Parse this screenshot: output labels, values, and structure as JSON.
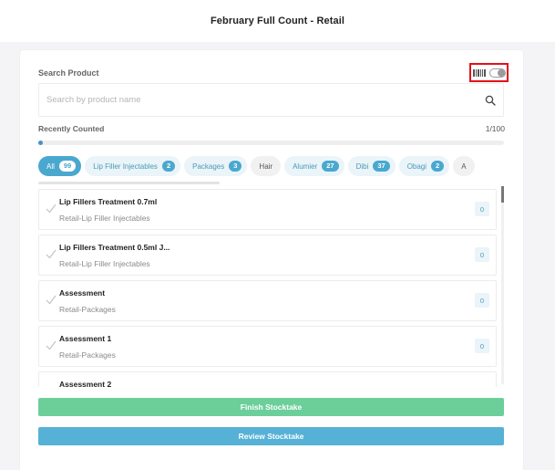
{
  "header": {
    "title": "February Full Count - Retail"
  },
  "search": {
    "label": "Search Product",
    "placeholder": "Search by product name",
    "value": ""
  },
  "scanner_toggle": {
    "enabled": false,
    "icon": "barcode-icon"
  },
  "recent": {
    "label": "Recently Counted",
    "count_text": "1/100",
    "progress_fraction": 0.01
  },
  "filters": [
    {
      "label": "All",
      "count": "99",
      "active": true
    },
    {
      "label": "Lip Filler Injectables",
      "count": "2",
      "active": false
    },
    {
      "label": "Packages",
      "count": "3",
      "active": false
    },
    {
      "label": "Hair",
      "count": "",
      "active": false
    },
    {
      "label": "Alumier",
      "count": "27",
      "active": false
    },
    {
      "label": "Dibi",
      "count": "37",
      "active": false
    },
    {
      "label": "Obagi",
      "count": "2",
      "active": false
    },
    {
      "label": "A",
      "count": "",
      "active": false
    }
  ],
  "items": [
    {
      "name": "Lip Fillers Treatment 0.7ml",
      "category": "Retail-Lip Filler Injectables",
      "qty": "0"
    },
    {
      "name": "Lip Fillers Treatment 0.5ml J...",
      "category": "Retail-Lip Filler Injectables",
      "qty": "0"
    },
    {
      "name": "Assessment",
      "category": "Retail-Packages",
      "qty": "0"
    },
    {
      "name": "Assessment 1",
      "category": "Retail-Packages",
      "qty": "0"
    },
    {
      "name": "Assessment 2",
      "category": "",
      "qty": ""
    }
  ],
  "actions": {
    "finish_label": "Finish Stocktake",
    "review_label": "Review Stocktake"
  },
  "colors": {
    "accent": "#4aa8cf",
    "finish": "#6ccf9a",
    "review": "#56b1d6",
    "highlight": "#e0121b"
  }
}
